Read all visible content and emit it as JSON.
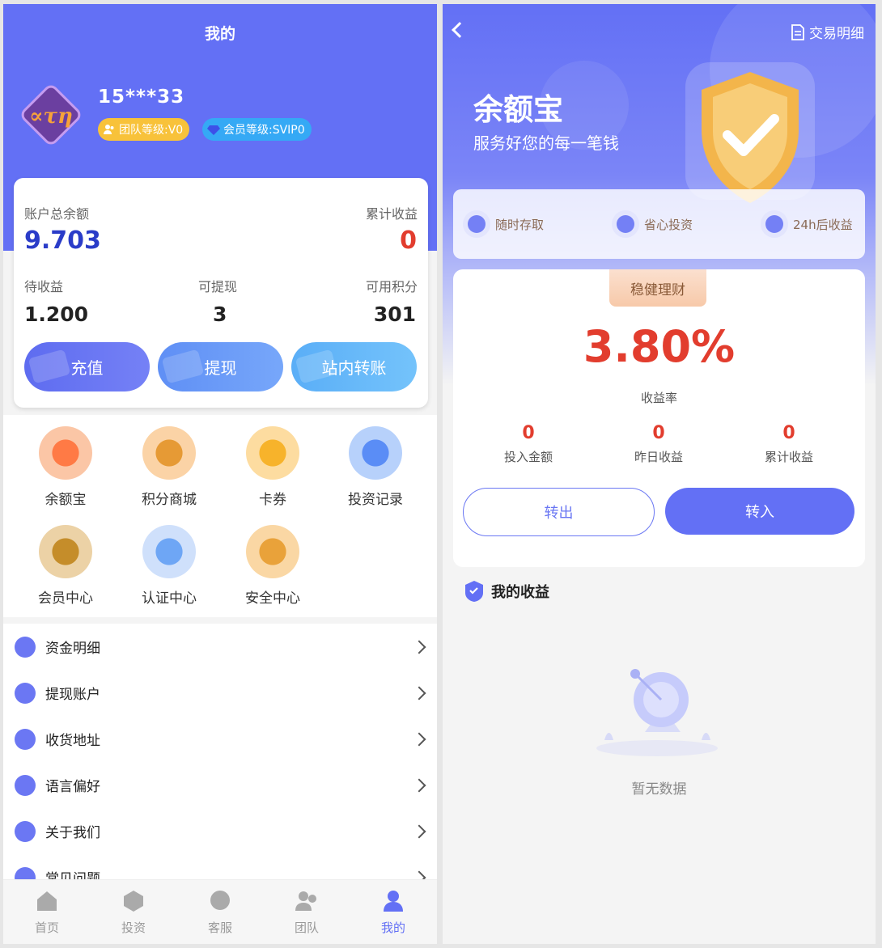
{
  "left": {
    "title": "我的",
    "user": {
      "name": "15***33",
      "team_level": "团队等级:V0",
      "member_level": "会员等级:SVIP0"
    },
    "account": {
      "total_balance_label": "账户总余额",
      "total_balance": "9.703",
      "cumulative_income_label": "累计收益",
      "cumulative_income": "0",
      "pending_label": "待收益",
      "pending": "1.200",
      "withdrawable_label": "可提现",
      "withdrawable": "3",
      "points_label": "可用积分",
      "points": "301"
    },
    "actions": {
      "recharge": "充值",
      "withdraw": "提现",
      "transfer": "站内转账"
    },
    "grid": [
      "余额宝",
      "积分商城",
      "卡券",
      "投资记录",
      "会员中心",
      "认证中心",
      "安全中心"
    ],
    "menu": [
      "资金明细",
      "提现账户",
      "收货地址",
      "语言偏好",
      "关于我们",
      "常见问题"
    ],
    "tabs": [
      "首页",
      "投资",
      "客服",
      "团队",
      "我的"
    ],
    "colors": {
      "primary": "#6370f5",
      "accent_red": "#e23d2e",
      "balance_blue": "#2a3cc8"
    }
  },
  "right": {
    "transaction_detail": "交易明细",
    "hero_title": "余额宝",
    "hero_subtitle": "服务好您的每一笔钱",
    "features": [
      "随时存取",
      "省心投资",
      "24h后收益"
    ],
    "ribbon": "稳健理财",
    "rate": "3.80%",
    "rate_label": "收益率",
    "stats": [
      {
        "value": "0",
        "label": "投入金额"
      },
      {
        "value": "0",
        "label": "昨日收益"
      },
      {
        "value": "0",
        "label": "累计收益"
      }
    ],
    "transfer_out": "转出",
    "transfer_in": "转入",
    "my_income": "我的收益",
    "empty_text": "暂无数据"
  }
}
